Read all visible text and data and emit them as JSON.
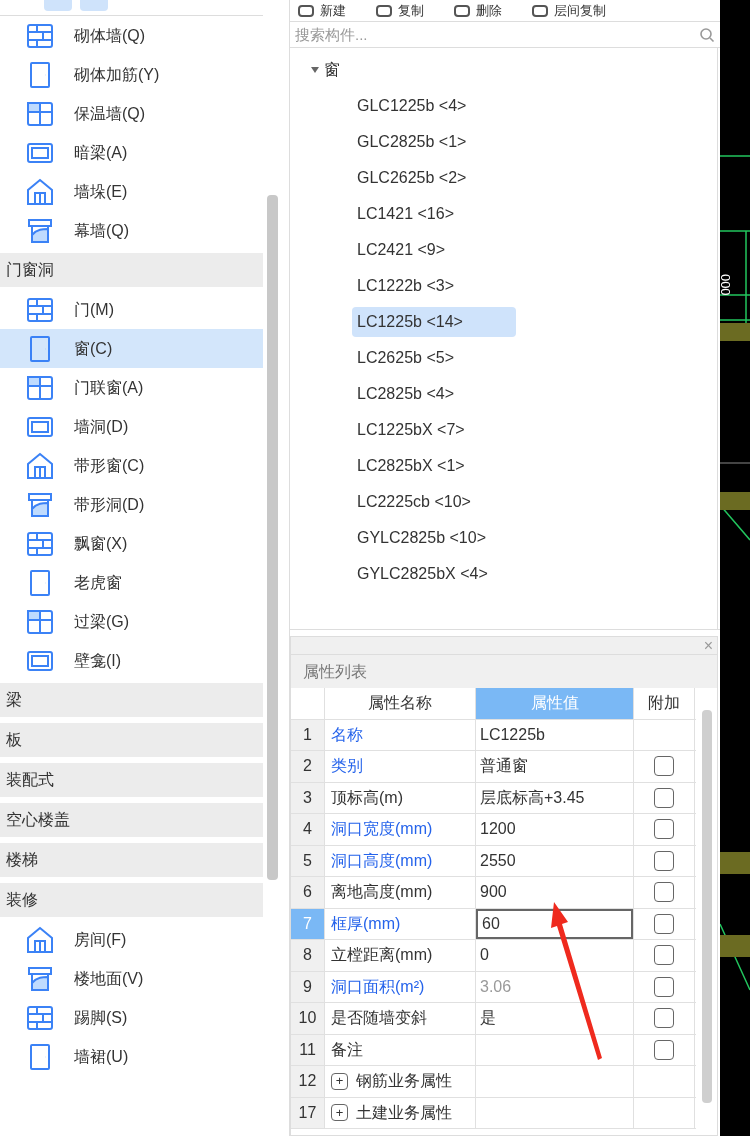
{
  "sidebar": {
    "sections": [
      {
        "items": [
          {
            "label": "砌体墙(Q)",
            "selected": false
          },
          {
            "label": "砌体加筋(Y)",
            "selected": false
          },
          {
            "label": "保温墙(Q)",
            "selected": false
          },
          {
            "label": "暗梁(A)",
            "selected": false
          },
          {
            "label": "墙垛(E)",
            "selected": false
          },
          {
            "label": "幕墙(Q)",
            "selected": false
          }
        ]
      },
      {
        "header": "门窗洞",
        "items": [
          {
            "label": "门(M)",
            "selected": false
          },
          {
            "label": "窗(C)",
            "selected": true
          },
          {
            "label": "门联窗(A)",
            "selected": false
          },
          {
            "label": "墙洞(D)",
            "selected": false
          },
          {
            "label": "带形窗(C)",
            "selected": false
          },
          {
            "label": "带形洞(D)",
            "selected": false
          },
          {
            "label": "飘窗(X)",
            "selected": false
          },
          {
            "label": "老虎窗",
            "selected": false
          },
          {
            "label": "过梁(G)",
            "selected": false
          },
          {
            "label": "壁龛(I)",
            "selected": false
          }
        ]
      },
      {
        "header": "梁"
      },
      {
        "header": "板"
      },
      {
        "header": "装配式"
      },
      {
        "header": "空心楼盖"
      },
      {
        "header": "楼梯"
      },
      {
        "header": "装修",
        "items": [
          {
            "label": "房间(F)",
            "selected": false
          },
          {
            "label": "楼地面(V)",
            "selected": false
          },
          {
            "label": "踢脚(S)",
            "selected": false
          },
          {
            "label": "墙裙(U)",
            "selected": false
          }
        ]
      }
    ]
  },
  "toolbar": [
    {
      "label": "新建"
    },
    {
      "label": "复制"
    },
    {
      "label": "删除"
    },
    {
      "label": "层间复制"
    }
  ],
  "search": {
    "placeholder": "搜索构件..."
  },
  "tree": {
    "label": "窗",
    "expanded": true,
    "children": [
      {
        "label": "GLC1225b <4>",
        "selected": false
      },
      {
        "label": "GLC2825b <1>",
        "selected": false
      },
      {
        "label": "GLC2625b <2>",
        "selected": false
      },
      {
        "label": "LC1421 <16>",
        "selected": false
      },
      {
        "label": "LC2421 <9>",
        "selected": false
      },
      {
        "label": "LC1222b <3>",
        "selected": false
      },
      {
        "label": "LC1225b <14>",
        "selected": true
      },
      {
        "label": "LC2625b <5>",
        "selected": false
      },
      {
        "label": "LC2825b <4>",
        "selected": false
      },
      {
        "label": "LC1225bX <7>",
        "selected": false
      },
      {
        "label": "LC2825bX <1>",
        "selected": false
      },
      {
        "label": "LC2225cb <10>",
        "selected": false
      },
      {
        "label": "GYLC2825b <10>",
        "selected": false
      },
      {
        "label": "GYLC2825bX <4>",
        "selected": false
      }
    ]
  },
  "properties": {
    "title": "属性列表",
    "close": "×",
    "columns": [
      {
        "label": "属性名称",
        "selected": false
      },
      {
        "label": "属性值",
        "selected": true
      },
      {
        "label": "附加",
        "selected": false
      }
    ],
    "rows": [
      {
        "kind": "field",
        "num": "1",
        "name": "名称",
        "value": "LC1225b",
        "highlighted": true,
        "selected": false
      },
      {
        "kind": "field",
        "num": "2",
        "name": "类别",
        "value": "普通窗",
        "highlighted": true,
        "selected": false,
        "checked": false
      },
      {
        "kind": "field",
        "num": "3",
        "name": "顶标高(m)",
        "value": "层底标高+3.45",
        "highlighted": false,
        "selected": false,
        "checked": false
      },
      {
        "kind": "field",
        "num": "4",
        "name": "洞口宽度(mm)",
        "value": "1200",
        "highlighted": true,
        "selected": false,
        "checked": false
      },
      {
        "kind": "field",
        "num": "5",
        "name": "洞口高度(mm)",
        "value": "2550",
        "highlighted": true,
        "selected": false,
        "checked": false
      },
      {
        "kind": "field",
        "num": "6",
        "name": "离地高度(mm)",
        "value": "900",
        "highlighted": false,
        "selected": false,
        "checked": false
      },
      {
        "kind": "field",
        "num": "7",
        "name": "框厚(mm)",
        "value": "60",
        "highlighted": true,
        "selected": true,
        "checked": false
      },
      {
        "kind": "field",
        "num": "8",
        "name": "立樘距离(mm)",
        "value": "0",
        "highlighted": false,
        "selected": false,
        "checked": false
      },
      {
        "kind": "field",
        "num": "9",
        "name": "洞口面积(m²)",
        "value": "3.06",
        "highlighted": true,
        "selected": false,
        "disabled": true,
        "checked": false
      },
      {
        "kind": "field",
        "num": "10",
        "name": "是否随墙变斜",
        "value": "是",
        "highlighted": false,
        "selected": false,
        "checked": false
      },
      {
        "kind": "field",
        "num": "11",
        "name": "备注",
        "highlighted": false,
        "selected": false,
        "checked": false
      },
      {
        "kind": "group",
        "num": "12",
        "name": "钢筋业务属性",
        "expanded": false,
        "expander": "+"
      },
      {
        "kind": "group",
        "num": "17",
        "name": "土建业务属性",
        "expanded": false,
        "expander": "+"
      }
    ]
  },
  "canvas": {
    "label": "000"
  }
}
